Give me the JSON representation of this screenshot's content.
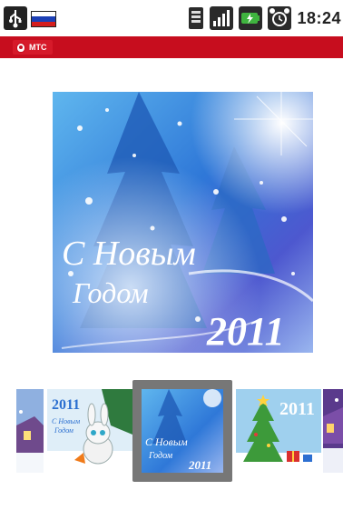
{
  "status_bar": {
    "time": "18:24",
    "icons": [
      "usb-icon",
      "flag-russia-icon",
      "sim-icon",
      "signal-icon",
      "battery-charging-icon",
      "alarm-icon"
    ]
  },
  "carrier": {
    "name": "МТС",
    "color": "#c70d1e"
  },
  "main_card": {
    "line1": "С Новым",
    "line2": "Годом",
    "year": "2011"
  },
  "gallery": {
    "thumbnails": [
      {
        "name": "thumb-winter-house",
        "year": ""
      },
      {
        "name": "thumb-bunny",
        "year": "2011",
        "line1": "С Новым",
        "line2": "Годом"
      },
      {
        "name": "thumb-selected-blue",
        "year": "2011",
        "line1": "С Новым",
        "line2": "Годом",
        "selected": true
      },
      {
        "name": "thumb-christmas-tree",
        "year": "2011"
      },
      {
        "name": "thumb-purple-house",
        "year": ""
      }
    ]
  }
}
